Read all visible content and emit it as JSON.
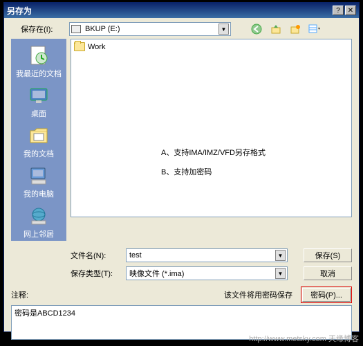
{
  "title": "另存为",
  "savein_label": "保存在(I):",
  "drive_text": "BKUP (E:)",
  "sidebar": [
    {
      "label": "我最近的文档"
    },
    {
      "label": "桌面"
    },
    {
      "label": "我的文档"
    },
    {
      "label": "我的电脑"
    },
    {
      "label": "网上邻居"
    }
  ],
  "folder_item": "Work",
  "hint1": "A、支持IMA/IMZ/VFD另存格式",
  "hint2": "B、支持加密码",
  "filename_label": "文件名(N):",
  "filename_value": "test",
  "filetype_label": "保存类型(T):",
  "filetype_value": "映像文件 (*.ima)",
  "save_btn": "保存(S)",
  "cancel_btn": "取消",
  "comment_label": "注释:",
  "pwd_notice": "该文件将用密码保存",
  "pwd_btn": "密码(P)...",
  "comment_text": "密码是ABCD1234",
  "footer": "http://www.metsky.com 天缘博客"
}
